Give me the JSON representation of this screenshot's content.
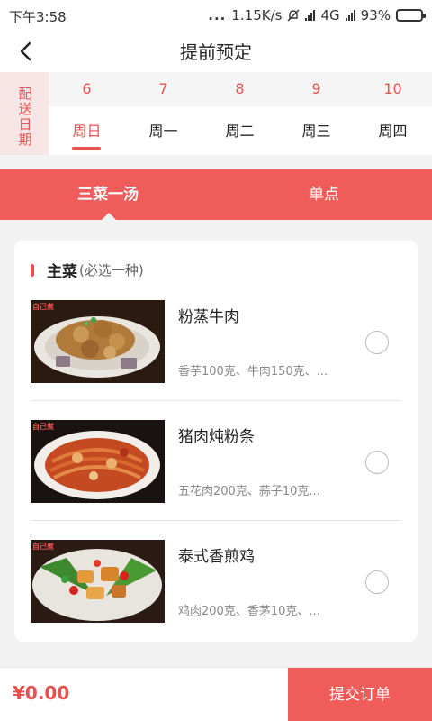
{
  "status_bar": {
    "time": "下午3:58",
    "dots": "...",
    "speed": "1.15K/s",
    "network": "4G",
    "battery": "93%"
  },
  "header": {
    "title": "提前预定",
    "back_icon": "chevron-left-icon"
  },
  "date_selector": {
    "label": "配送日期",
    "days": [
      {
        "num": "6",
        "weekday": "周日",
        "active": true
      },
      {
        "num": "7",
        "weekday": "周一",
        "active": false
      },
      {
        "num": "8",
        "weekday": "周二",
        "active": false
      },
      {
        "num": "9",
        "weekday": "周三",
        "active": false
      },
      {
        "num": "10",
        "weekday": "周四",
        "active": false
      }
    ]
  },
  "menu_tabs": {
    "combo": "三菜一汤",
    "single": "单点"
  },
  "section": {
    "title": "主菜",
    "hint": "(必选一种)"
  },
  "dishes": [
    {
      "name": "粉蒸牛肉",
      "ingredients": "香芋100克、牛肉150克、...",
      "brand": "自己煮"
    },
    {
      "name": "猪肉炖粉条",
      "ingredients": "五花肉200克、蒜子10克...",
      "brand": "自己煮"
    },
    {
      "name": "泰式香煎鸡",
      "ingredients": "鸡肉200克、香茅10克、...",
      "brand": "自己煮"
    }
  ],
  "bottom_bar": {
    "price": "¥0.00",
    "submit": "提交订单"
  },
  "colors": {
    "accent": "#ef5c5a",
    "accent_text": "#e8514f",
    "date_label_bg": "#f8e5e5"
  }
}
